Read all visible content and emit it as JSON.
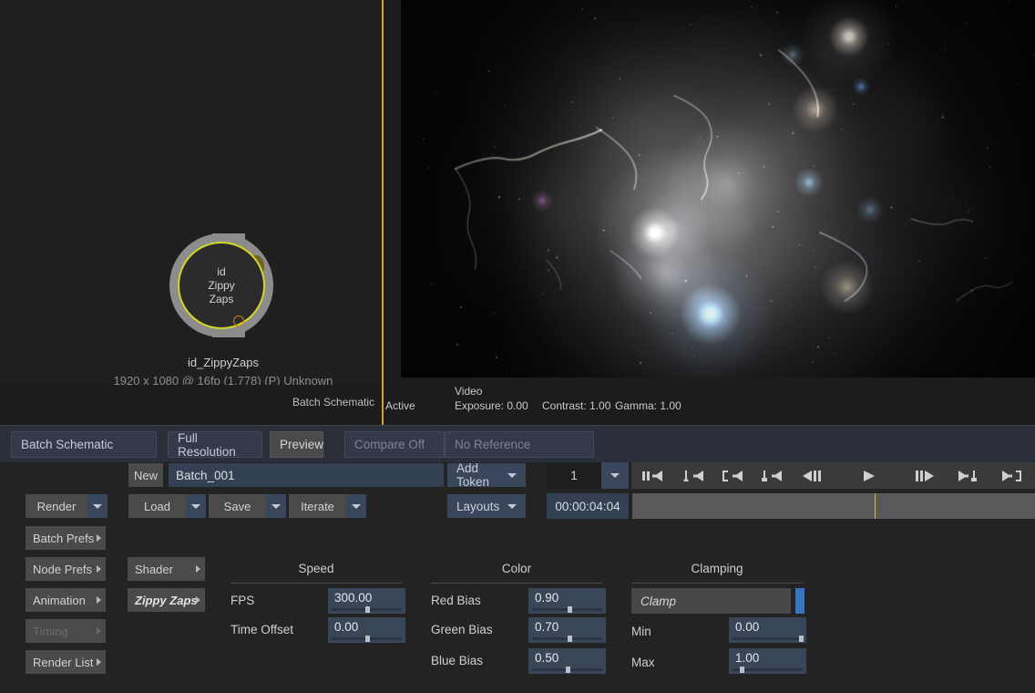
{
  "schematic": {
    "node": {
      "title_lines": [
        "id",
        "Zippy",
        "Zaps"
      ],
      "label": "id_ZippyZaps",
      "info": "1920 x 1080 @ 16fp (1.778) (P) Unknown"
    },
    "status": "Batch Schematic"
  },
  "viewer": {
    "active": "Active",
    "video": "Video",
    "exposure": "Exposure: 0.00",
    "contrast": "Contrast: 1.00",
    "gamma": "Gamma: 1.00"
  },
  "tabs": [
    {
      "label": "Batch Schematic",
      "state": "normal"
    },
    {
      "label": "Full Resolution",
      "state": "normal"
    },
    {
      "label": "Preview",
      "state": "grey"
    },
    {
      "label": "Compare Off",
      "state": "dim"
    },
    {
      "label": "No Reference",
      "state": "dim"
    }
  ],
  "toolbar": {
    "new_label": "New",
    "batch_name": "Batch_001",
    "add_token": "Add Token",
    "layouts": "Layouts",
    "render": "Render",
    "load": "Load",
    "save": "Save",
    "iterate": "Iterate",
    "batch_prefs": "Batch Prefs",
    "node_prefs": "Node Prefs",
    "animation": "Animation",
    "timing": "Timing",
    "render_list": "Render List",
    "shader": "Shader",
    "zippy_zaps": "Zippy Zaps"
  },
  "transport": {
    "frame": "1",
    "timecode": "00:00:04:04",
    "buttons": [
      "goto-start-icon",
      "prev-keyframe-icon",
      "prev-clip-icon",
      "prev-marker-icon",
      "step-back-icon",
      "play-icon",
      "step-forward-icon",
      "next-marker-icon",
      "goto-end-icon"
    ]
  },
  "params": {
    "speed": {
      "title": "Speed",
      "rows": [
        {
          "label": "FPS",
          "value": "300.00",
          "thumb_pct": 50
        },
        {
          "label": "Time Offset",
          "value": "0.00",
          "thumb_pct": 50
        }
      ]
    },
    "color": {
      "title": "Color",
      "rows": [
        {
          "label": "Red Bias",
          "value": "0.90",
          "thumb_pct": 52
        },
        {
          "label": "Green Bias",
          "value": "0.70",
          "thumb_pct": 52
        },
        {
          "label": "Blue Bias",
          "value": "0.50",
          "thumb_pct": 50
        }
      ]
    },
    "clamping": {
      "title": "Clamping",
      "mode": "Clamp",
      "rows": [
        {
          "label": "Min",
          "value": "0.00",
          "thumb_pct": 94
        },
        {
          "label": "Max",
          "value": "1.00",
          "thumb_pct": 16
        }
      ]
    }
  },
  "colors": {
    "accent_border": "#d8a02a",
    "node_ring": "#d3d627",
    "blue_toggle": "#3873c6",
    "playhead": "#d5c121"
  }
}
